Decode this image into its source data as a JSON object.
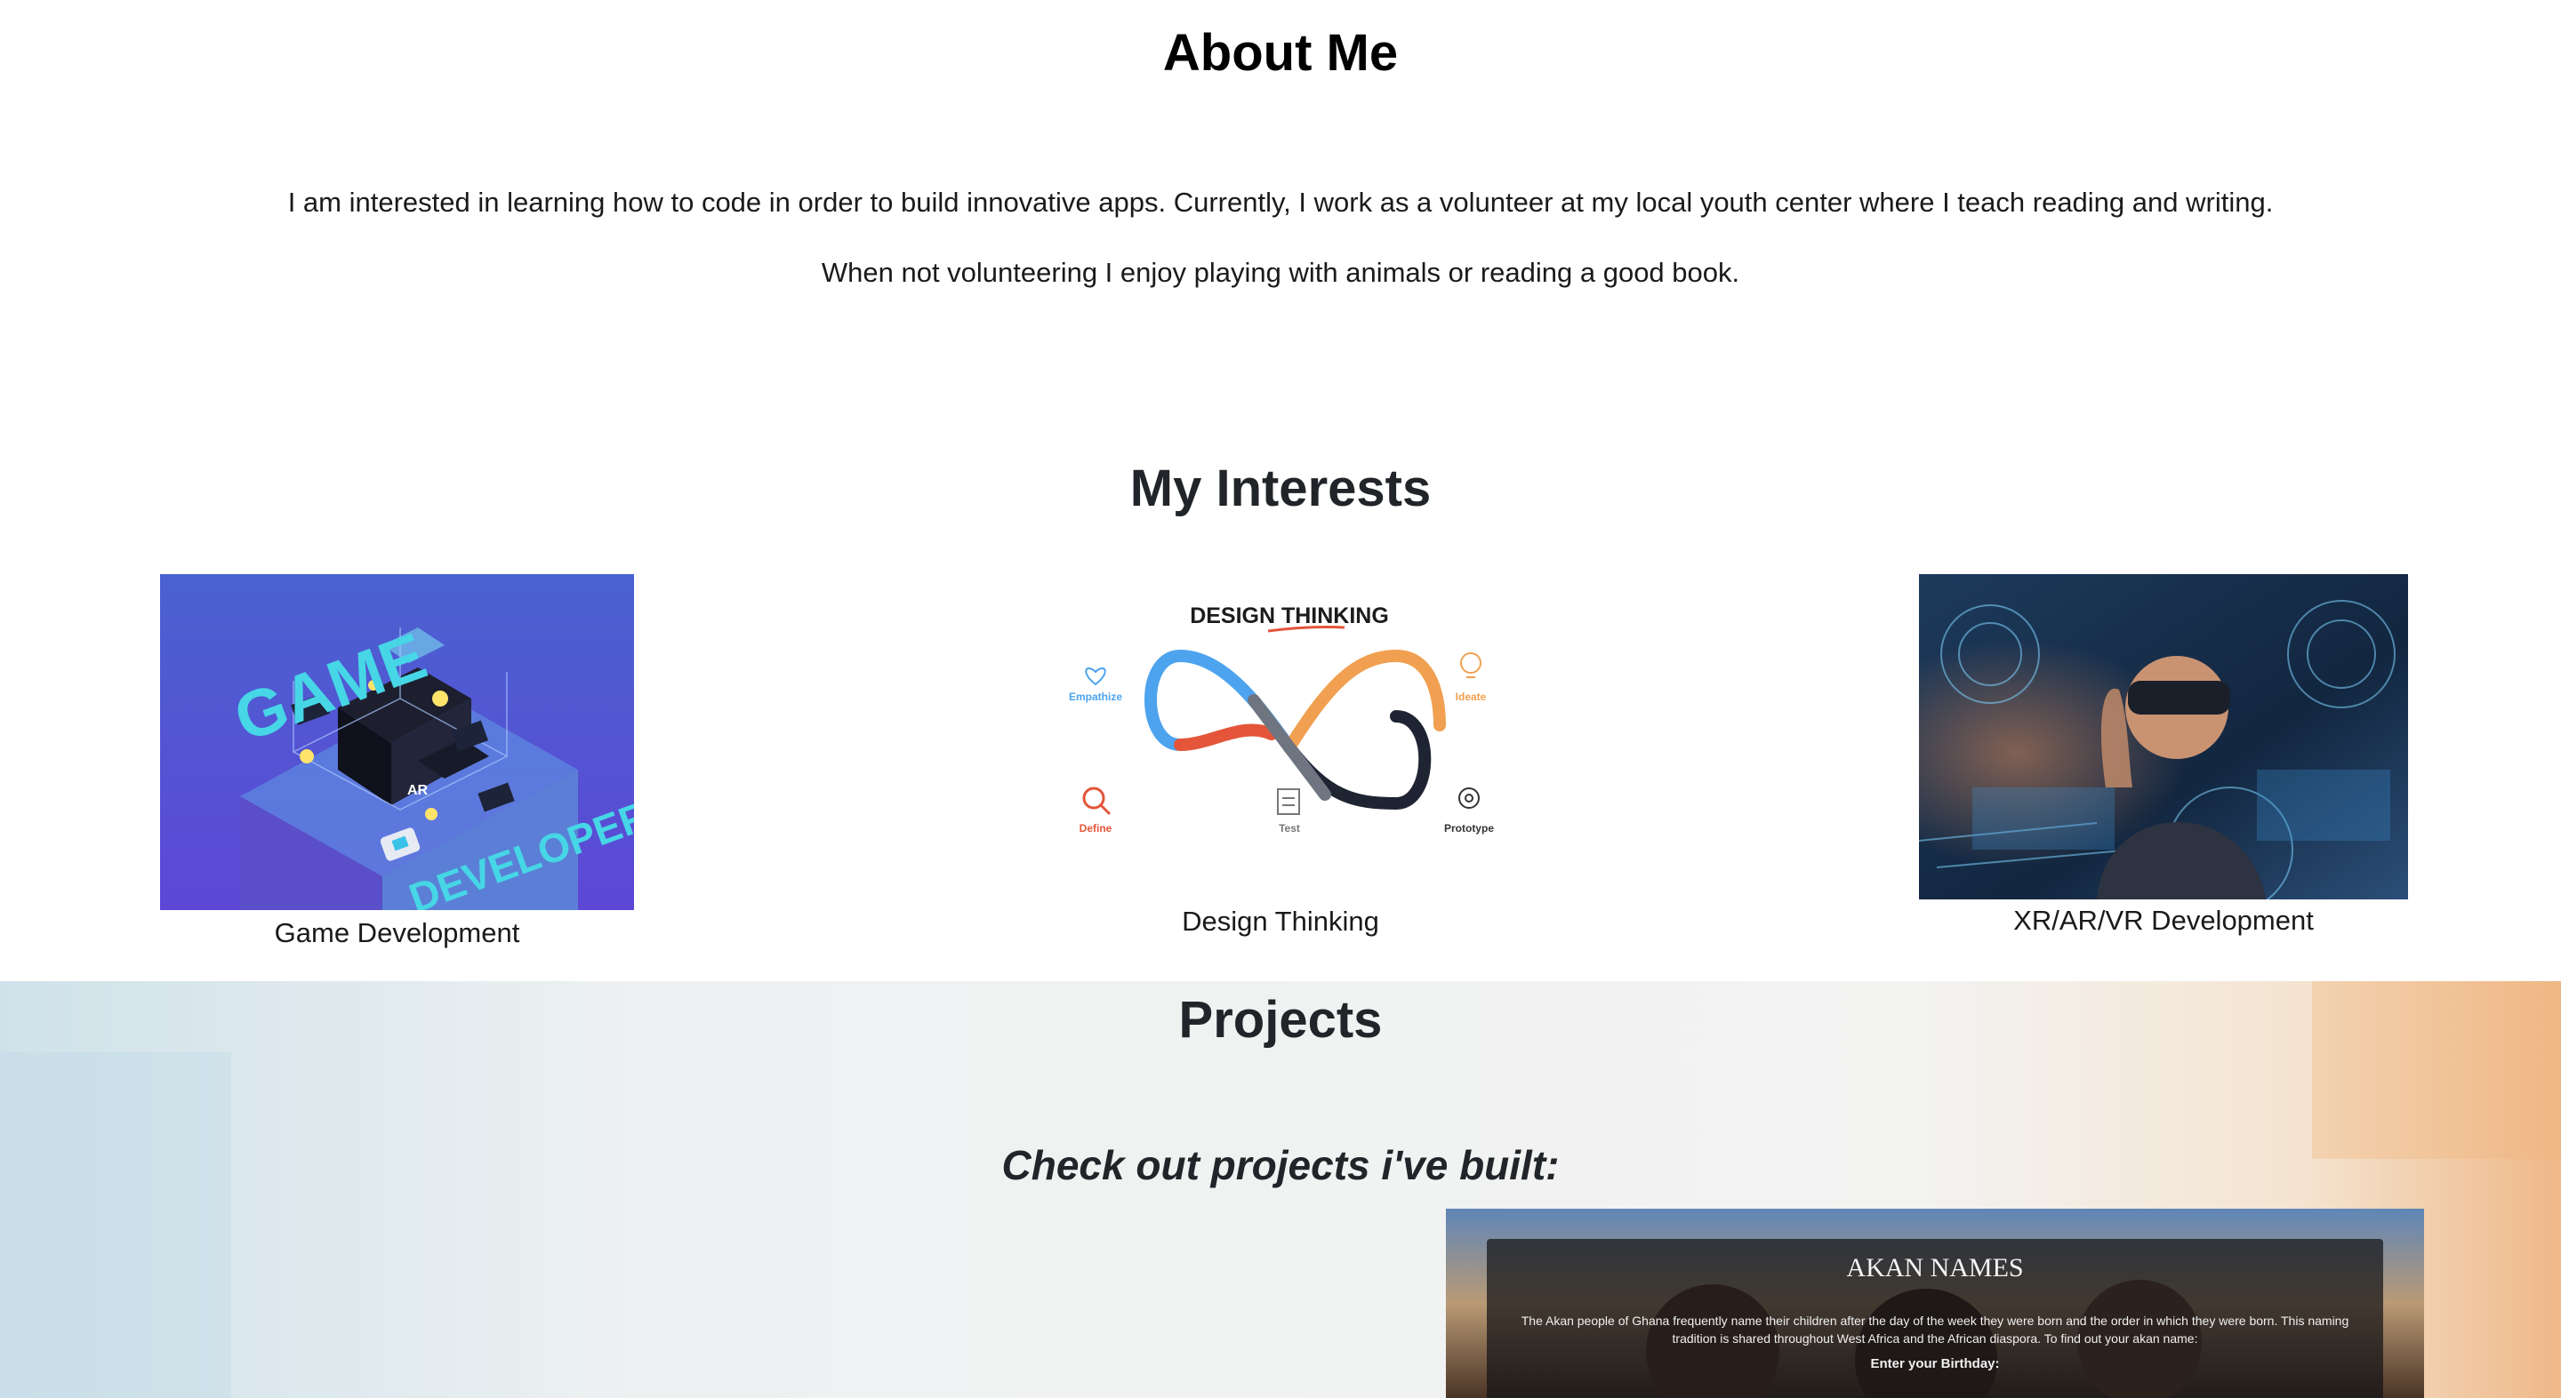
{
  "about": {
    "title": "About Me",
    "paragraph_1": "I am interested in learning how to code in order to build innovative apps. Currently, I work as a volunteer at my local youth center where I teach reading and writing.",
    "paragraph_2": "When not volunteering I enjoy playing with animals or reading a good book."
  },
  "interests": {
    "title": "My Interests",
    "items": [
      {
        "caption": "Game Development",
        "image_text": [
          "GAME",
          "DEVELOPER",
          "AR"
        ]
      },
      {
        "caption": "Design Thinking",
        "image_text": {
          "heading": "DESIGN THINKING",
          "stages": [
            "Empathize",
            "Ideate",
            "Define",
            "Test",
            "Prototype"
          ]
        }
      },
      {
        "caption": "XR/AR/VR Development"
      }
    ]
  },
  "projects": {
    "title": "Projects",
    "subtitle": "Check out projects i've built:",
    "preview": {
      "title": "AKAN NAMES",
      "description": "The Akan people of Ghana frequently name their children after the day of the week they were born and the order in which they were born. This naming tradition is shared throughout West Africa and the African diaspora. To find out your akan name:",
      "label": "Enter your Birthday:"
    }
  },
  "colors": {
    "game_bg": "#4a5bd3",
    "empathize": "#4da3ee",
    "ideate": "#f0a050",
    "define": "#e4553a",
    "heading_text": "#212529"
  }
}
